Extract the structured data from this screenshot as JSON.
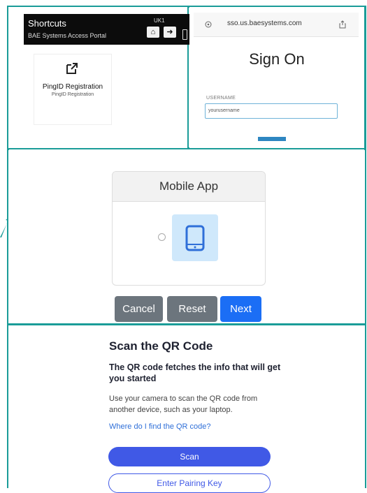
{
  "shortcuts": {
    "title": "Shortcuts",
    "subtitle": "BAE Systems Access Portal",
    "region": "UK1",
    "home_icon": "home-icon",
    "logout_icon": "logout-icon",
    "tile": {
      "icon": "external-link-icon",
      "name": "PingID Registration",
      "sub": "PingID Registration"
    }
  },
  "signon": {
    "url": "sso.us.baesystems.com",
    "title": "Sign On",
    "username_label": "USERNAME",
    "username_value": "yourusername"
  },
  "mobile_app": {
    "header": "Mobile App",
    "icon": "mobile-phone-icon",
    "buttons": {
      "cancel": "Cancel",
      "reset": "Reset",
      "next": "Next"
    }
  },
  "qr": {
    "title": "Scan the QR Code",
    "subtitle": "The QR code fetches the info that will get you started",
    "body": "Use your camera to scan the QR code from another device, such as your laptop.",
    "link": "Where do I find the QR code?",
    "scan_label": "Scan",
    "pair_label": "Enter Pairing Key"
  },
  "colors": {
    "border": "#1a9c98",
    "next_button": "#1b6ef5",
    "scan_button": "#4059e6",
    "phone_tile": "#cfe8fb"
  }
}
